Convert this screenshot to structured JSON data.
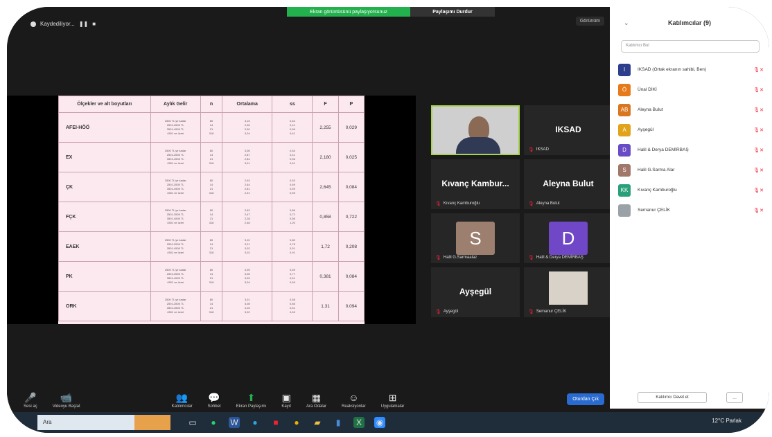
{
  "banner": {
    "share_text": "Ekran görüntüsünü paylaşıyorsunuz",
    "stop_text": "Paylaşımı Durdur"
  },
  "recording": {
    "label": "Kaydediliyor..."
  },
  "top_right": {
    "view_label": "Görünüm"
  },
  "table": {
    "headers": [
      "Ölçekler ve alt boyutları",
      "Aylık Gelir",
      "n",
      "Ortalama",
      "ss",
      "F",
      "P"
    ],
    "rows": [
      {
        "factor": "AFEI-HÖÖ",
        "income": "2500 TL'ye kadar | 2501-3500 TL | 3501-4500 TL | 4501 ve üzeri",
        "n": "80 | 14 | 21 | 318",
        "mean": "3,15 | 2,96 | 2,90 | 3,04",
        "sd": "0,64 | 0,41 | 0,56 | 0,61",
        "F": "2,255",
        "P": "0,029"
      },
      {
        "factor": "EX",
        "income": "2500 TL'ye kadar | 2501-3500 TL | 3501-4500 TL | 4501 ve üzeri",
        "n": "80 | 14 | 21 | 318",
        "mean": "3,06 | 2,87 | 2,84 | 3,01",
        "sd": "0,64 | 0,41 | 0,56 | 0,61",
        "F": "2,180",
        "P": "0,025"
      },
      {
        "factor": "ÇK",
        "income": "2500 TL'ye kadar | 2501-3500 TL | 3501-4500 TL | 4501 ve üzeri",
        "n": "80 | 14 | 21 | 318",
        "mean": "2,93 | 2,64 | 2,81 | 2,91",
        "sd": "0,53 | 0,69 | 0,59 | 0,59",
        "F": "2,645",
        "P": "0,084"
      },
      {
        "factor": "FÇK",
        "income": "2500 TL'ye kadar | 2501-3500 TL | 3501-4500 TL | 4501 ve üzeri",
        "n": "80 | 14 | 21 | 318",
        "mean": "2,62 | 2,47 | 2,28 | 2,48",
        "sd": "0,86 | 0,72 | 0,56 | 1,20",
        "F": "0,858",
        "P": "0,722"
      },
      {
        "factor": "EAEK",
        "income": "2500 TL'ye kadar | 2501-3500 TL | 3501-4500 TL | 4501 ve üzeri",
        "n": "80 | 14 | 21 | 318",
        "mean": "3,10 | 3,21 | 3,02 | 3,02",
        "sd": "0,80 | 0,78 | 0,51 | 0,91",
        "F": "1,72",
        "P": "0,208"
      },
      {
        "factor": "PK",
        "income": "2500 TL'ye kadar | 2501-3500 TL | 3501-4500 TL | 4501 ve üzeri",
        "n": "80 | 14 | 21 | 318",
        "mean": "3,05 | 3,06 | 3,09 | 3,04",
        "sd": "0,69 | 0,77 | 0,61 | 0,69",
        "F": "0,381",
        "P": "0,084"
      },
      {
        "factor": "ORK",
        "income": "2500 TL'ye kadar | 2501-3500 TL | 3501-4500 TL | 4501 ve üzeri",
        "n": "80 | 14 | 21 | 318",
        "mean": "3,01 | 3,08 | 3,16 | 3,02",
        "sd": "0,58 | 0,85 | 0,61 | 0,63",
        "F": "1,31",
        "P": "0,094"
      }
    ]
  },
  "tiles": [
    {
      "name": "",
      "label": "",
      "kind": "video"
    },
    {
      "name": "IKSAD",
      "label": "IKSAD",
      "kind": "name"
    },
    {
      "name": "Kıvanç Kambur...",
      "label": "Kıvanç Kamburoğlu",
      "kind": "name"
    },
    {
      "name": "Aleyna Bulut",
      "label": "Aleyna Bulut",
      "kind": "name"
    },
    {
      "name": "S",
      "label": "Halil G.Sarmaalaz",
      "kind": "avatar",
      "color": "#9c7f6e"
    },
    {
      "name": "D",
      "label": "Halil & Derya DEMİRBAŞ",
      "kind": "avatar",
      "color": "#6f47c7"
    },
    {
      "name": "Ayşegül",
      "label": "Ayşegül",
      "kind": "name"
    },
    {
      "name": "",
      "label": "Semanur ÇELİK",
      "kind": "photo"
    }
  ],
  "controls": [
    {
      "icon": "mic-icon",
      "glyph": "🎤",
      "label": "Sesi aç"
    },
    {
      "icon": "video-icon",
      "glyph": "📹",
      "label": "Videoyu Başlat"
    },
    {
      "icon": "participants-icon",
      "glyph": "👥",
      "label": "Katılımcılar"
    },
    {
      "icon": "chat-icon",
      "glyph": "💬",
      "label": "Sohbet"
    },
    {
      "icon": "share-screen-icon",
      "glyph": "⬆",
      "label": "Ekran Paylaşımı"
    },
    {
      "icon": "cc-icon",
      "glyph": "▣",
      "label": "Kayıt"
    },
    {
      "icon": "breakout-icon",
      "glyph": "▦",
      "label": "Ara Odalar"
    },
    {
      "icon": "reactions-icon",
      "glyph": "☺",
      "label": "Reaksiyonlar"
    },
    {
      "icon": "apps-icon",
      "glyph": "⊞",
      "label": "Uygulamalar"
    }
  ],
  "end_button": "Oturdan Çık",
  "panel": {
    "title": "Katılımcılar (9)",
    "search_placeholder": "Katılımcı Bul",
    "participants": [
      {
        "initials": "I",
        "name": "IKSAD (Ortak ekranın sahibi, Ben)",
        "color": "#2c3e8c"
      },
      {
        "initials": "Ö",
        "name": "Ünal DİKİ",
        "color": "#e67a1a"
      },
      {
        "initials": "AB",
        "name": "Aleyna Bulut",
        "color": "#d9761f"
      },
      {
        "initials": "A",
        "name": "Ayşegül",
        "color": "#e0a31a"
      },
      {
        "initials": "D",
        "name": "Halil & Derya DEMİRBAŞ",
        "color": "#6a4bc6"
      },
      {
        "initials": "S",
        "name": "Halil G.Sarma Alar",
        "color": "#a1776a"
      },
      {
        "initials": "KK",
        "name": "Kıvanç Kamburoğlu",
        "color": "#2aa07a"
      },
      {
        "initials": "",
        "name": "Semanur ÇELİK",
        "color": "#9aa2a8"
      }
    ],
    "invite_label": "Katılımcı Davet et",
    "more_label": "..."
  },
  "taskbar": {
    "search": "Ara",
    "weather": "12°C Parlak"
  }
}
